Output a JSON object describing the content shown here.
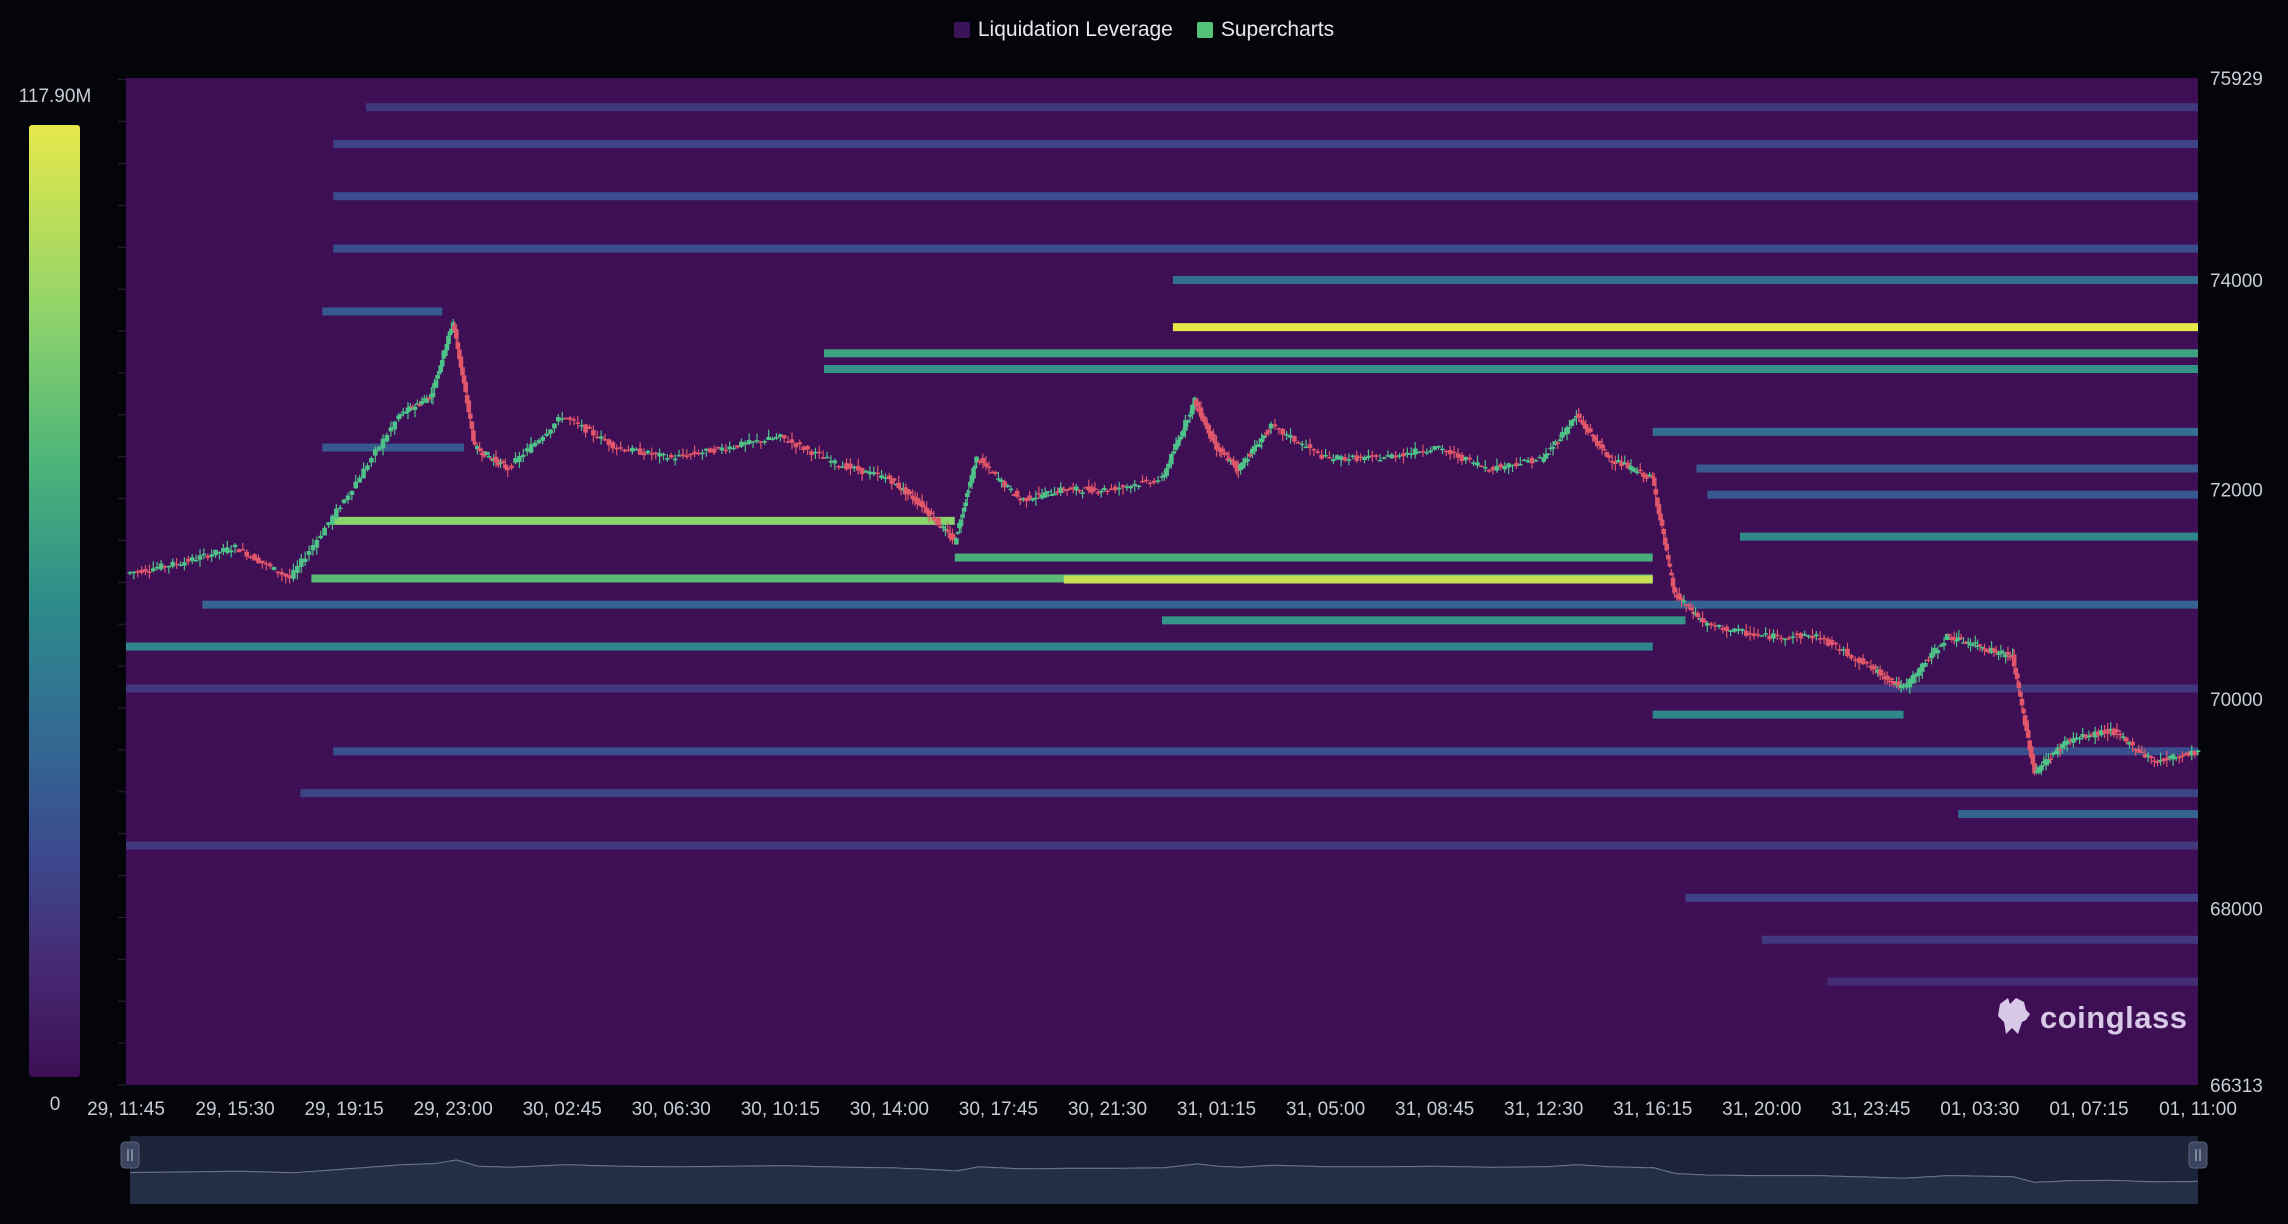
{
  "legend": [
    {
      "label": "Liquidation Leverage",
      "color": "#3a1458"
    },
    {
      "label": "Supercharts",
      "color": "#55c27a"
    }
  ],
  "colorbar": {
    "max_label": "117.90M",
    "min_label": "0",
    "colors": [
      "#3e0f55",
      "#462b74",
      "#3b4b8e",
      "#336a93",
      "#2e8c8a",
      "#4bb37a",
      "#8ed36b",
      "#e6e84a"
    ]
  },
  "watermark": "coinglass",
  "chart_data": {
    "type": "heatmap",
    "title": "",
    "xlabel": "",
    "ylabel": "",
    "ylim": [
      66313,
      75929
    ],
    "y_ticks": [
      "75929",
      "74000",
      "72000",
      "70000",
      "68000",
      "66313"
    ],
    "x_ticks": [
      "29, 11:45",
      "29, 15:30",
      "29, 19:15",
      "29, 23:00",
      "30, 02:45",
      "30, 06:30",
      "30, 10:15",
      "30, 14:00",
      "30, 17:45",
      "30, 21:30",
      "31, 01:15",
      "31, 05:00",
      "31, 08:45",
      "31, 12:30",
      "31, 16:15",
      "31, 20:00",
      "31, 23:45",
      "01, 03:30",
      "01, 07:15",
      "01, 11:00"
    ],
    "value_range": [
      0,
      117.9
    ],
    "value_unit": "M",
    "liquidation_bands": [
      {
        "price": 73550,
        "start": 9.6,
        "end": 19.0,
        "intensity": 1.0
      },
      {
        "price": 73300,
        "start": 6.4,
        "end": 19.0,
        "intensity": 0.65
      },
      {
        "price": 73150,
        "start": 6.4,
        "end": 19.0,
        "intensity": 0.6
      },
      {
        "price": 74000,
        "start": 9.6,
        "end": 19.0,
        "intensity": 0.45
      },
      {
        "price": 74300,
        "start": 1.9,
        "end": 19.0,
        "intensity": 0.3
      },
      {
        "price": 74800,
        "start": 1.9,
        "end": 19.0,
        "intensity": 0.3
      },
      {
        "price": 75300,
        "start": 1.9,
        "end": 19.0,
        "intensity": 0.25
      },
      {
        "price": 75650,
        "start": 2.2,
        "end": 19.0,
        "intensity": 0.2
      },
      {
        "price": 72550,
        "start": 14.0,
        "end": 19.0,
        "intensity": 0.45
      },
      {
        "price": 72200,
        "start": 14.4,
        "end": 19.0,
        "intensity": 0.35
      },
      {
        "price": 71950,
        "start": 14.5,
        "end": 19.0,
        "intensity": 0.35
      },
      {
        "price": 71700,
        "start": 1.9,
        "end": 7.6,
        "intensity": 0.85
      },
      {
        "price": 71550,
        "start": 14.8,
        "end": 19.0,
        "intensity": 0.55
      },
      {
        "price": 71350,
        "start": 7.6,
        "end": 14.0,
        "intensity": 0.7
      },
      {
        "price": 71150,
        "start": 1.7,
        "end": 14.0,
        "intensity": 0.75
      },
      {
        "price": 71140,
        "start": 8.6,
        "end": 14.0,
        "intensity": 0.95
      },
      {
        "price": 70900,
        "start": 0.7,
        "end": 19.0,
        "intensity": 0.4
      },
      {
        "price": 70750,
        "start": 9.5,
        "end": 14.3,
        "intensity": 0.6
      },
      {
        "price": 70500,
        "start": 0.0,
        "end": 14.0,
        "intensity": 0.55
      },
      {
        "price": 70100,
        "start": 0.0,
        "end": 19.0,
        "intensity": 0.2
      },
      {
        "price": 69850,
        "start": 14.0,
        "end": 16.3,
        "intensity": 0.55
      },
      {
        "price": 69500,
        "start": 1.9,
        "end": 19.0,
        "intensity": 0.3
      },
      {
        "price": 69100,
        "start": 1.6,
        "end": 19.0,
        "intensity": 0.25
      },
      {
        "price": 68900,
        "start": 16.8,
        "end": 19.0,
        "intensity": 0.4
      },
      {
        "price": 68600,
        "start": 0.0,
        "end": 19.0,
        "intensity": 0.2
      },
      {
        "price": 68100,
        "start": 14.3,
        "end": 19.0,
        "intensity": 0.25
      },
      {
        "price": 67700,
        "start": 15.0,
        "end": 19.0,
        "intensity": 0.2
      },
      {
        "price": 67300,
        "start": 15.6,
        "end": 19.0,
        "intensity": 0.15
      },
      {
        "price": 72400,
        "start": 1.8,
        "end": 3.1,
        "intensity": 0.35
      },
      {
        "price": 73700,
        "start": 1.8,
        "end": 2.9,
        "intensity": 0.35
      }
    ],
    "price_series": {
      "t": [
        0,
        0.5,
        1.0,
        1.5,
        2.0,
        2.5,
        2.8,
        3.0,
        3.2,
        3.5,
        4.0,
        4.5,
        5.0,
        5.5,
        6.0,
        6.5,
        7.0,
        7.3,
        7.6,
        7.8,
        8.2,
        8.6,
        9.0,
        9.5,
        9.8,
        10.0,
        10.2,
        10.5,
        11.0,
        11.5,
        12.0,
        12.5,
        13.0,
        13.3,
        13.6,
        14.0,
        14.2,
        14.5,
        15.0,
        15.5,
        16.0,
        16.3,
        16.7,
        17.0,
        17.3,
        17.5,
        17.8,
        18.2,
        18.6,
        19.0
      ],
      "price": [
        71200,
        71300,
        71450,
        71150,
        71900,
        72700,
        72900,
        73600,
        72400,
        72200,
        72700,
        72400,
        72300,
        72400,
        72500,
        72250,
        72100,
        71850,
        71500,
        72300,
        71900,
        72000,
        72000,
        72100,
        72850,
        72400,
        72200,
        72600,
        72300,
        72300,
        72400,
        72200,
        72300,
        72700,
        72300,
        72100,
        71000,
        70700,
        70600,
        70600,
        70300,
        70100,
        70600,
        70500,
        70400,
        69300,
        69600,
        69700,
        69400,
        69500
      ]
    }
  }
}
